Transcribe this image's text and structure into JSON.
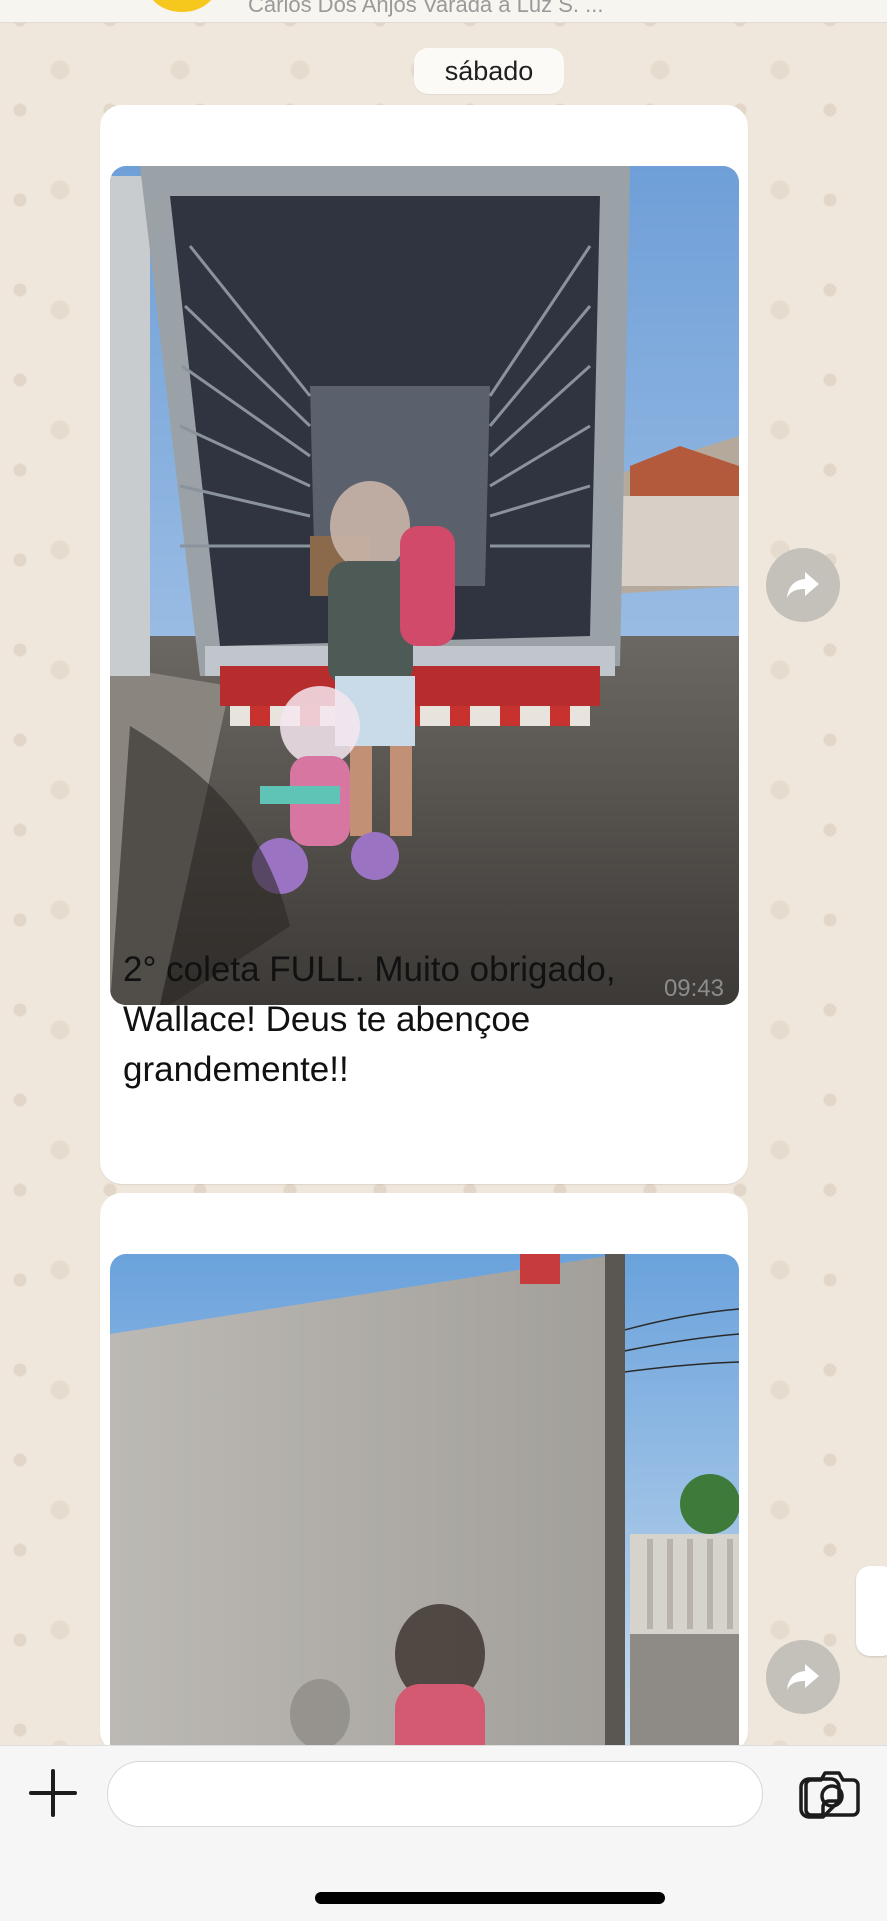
{
  "header": {
    "subtitle": "Carlos Dos Anjos Varada a Luz S. ..."
  },
  "chat": {
    "date_label": "sábado",
    "messages": [
      {
        "caption": "2° coleta FULL. Muito obrigado, Wallace! Deus te abençoe grandemente!!",
        "time": "09:43",
        "photo_desc": "truck-interior-photo"
      },
      {
        "caption": "",
        "time": "",
        "photo_desc": "truck-side-photo"
      }
    ]
  },
  "composer": {
    "input_value": "",
    "input_placeholder": ""
  },
  "icons": {
    "attach": "plus-icon",
    "forward": "forward-arrow-icon",
    "sticker": "sticker-icon",
    "camera": "camera-icon"
  },
  "colors": {
    "wallpaper": "#efe7dc",
    "bubble": "#ffffff",
    "forward_button": "#c4c0ba"
  }
}
